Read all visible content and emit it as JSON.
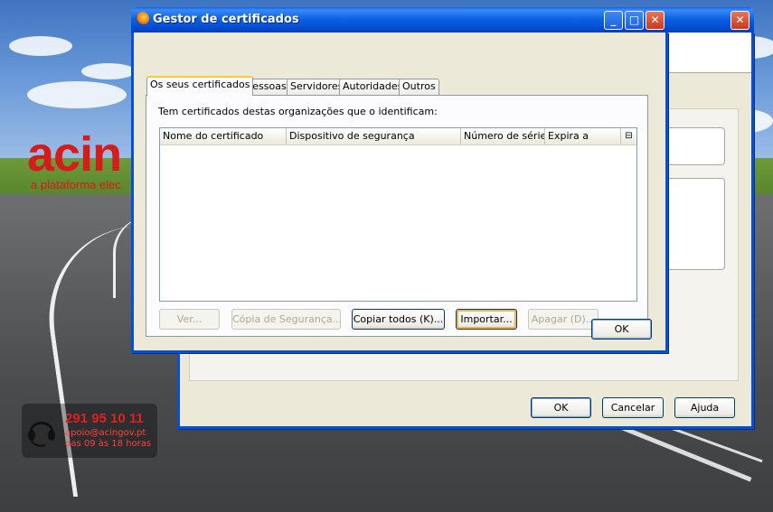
{
  "background": {
    "brand_logo": "acin",
    "brand_tagline": "a plataforma elec",
    "support": {
      "phone": "291 95 10 11",
      "email": "apoio@acingov.pt",
      "hours": "das 09 às 18 horas"
    }
  },
  "back_dialog": {
    "ok_label": "OK",
    "cancel_label": "Cancelar",
    "help_label": "Ajuda",
    "close_icon": "close-icon"
  },
  "cert_manager": {
    "title": "Gestor de certificados",
    "app_icon": "firefox-icon",
    "title_buttons": [
      "minimize-icon",
      "maximize-icon",
      "close-icon"
    ],
    "tabs": [
      {
        "label": "Os seus certificados",
        "active": true
      },
      {
        "label": "Pessoas",
        "active": false
      },
      {
        "label": "Servidores",
        "active": false
      },
      {
        "label": "Autoridades",
        "active": false
      },
      {
        "label": "Outros",
        "active": false
      }
    ],
    "description": "Tem certificados destas organizações que o identificam:",
    "columns": [
      "Nome do certificado",
      "Dispositivo de segurança",
      "Número de série",
      "Expira a"
    ],
    "column_picker_icon": "column-picker-icon",
    "rows": [],
    "actions": {
      "view": "Ver...",
      "backup": "Cópia de Segurança...",
      "backup_all": "Copiar todos (K)...",
      "import": "Importar...",
      "delete": "Apagar (D)..."
    },
    "ok_label": "OK"
  },
  "colors": {
    "title_bar": "#0a5ee2",
    "window_face": "#ece9d8",
    "brand_red": "#d61b1b"
  }
}
